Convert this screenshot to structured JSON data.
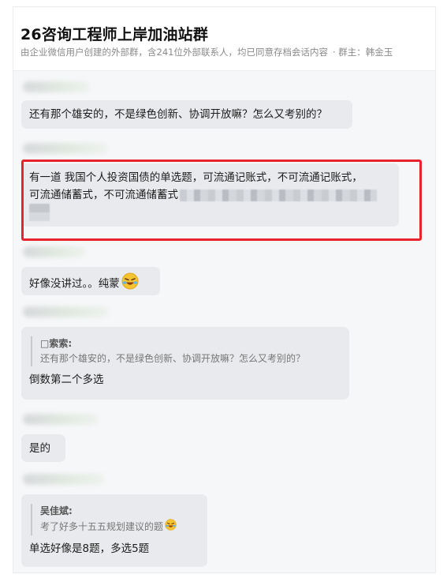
{
  "header": {
    "title": "26咨询工程师上岸加油站群",
    "subtitle": "由企业微信用户创建的外部群，含241位外部联系人，均已同意存档会话内容",
    "owner": "· 群主：韩金玉"
  },
  "messages": [
    {
      "text": "还有那个雄安的，不是绿色创新、协调开放嘛？怎么又考别的？"
    },
    {
      "line1": "有一道 我国个人投资国债的单选题，可流通记账式，不可流通记账式，",
      "line2": "可流通储蓄式，不可流通储蓄式"
    },
    {
      "text": "好像没讲过。。纯蒙",
      "emoji": "laughing-tears-icon"
    },
    {
      "quote_name": "□索索:",
      "quote_text": "还有那个雄安的，不是绿色创新、协调开放嘛？怎么又考别的？",
      "reply": "倒数第二个多选"
    },
    {
      "text": "是的"
    },
    {
      "quote_name": "吴佳斌:",
      "quote_text": "考了好多十五五规划建议的题",
      "quote_emoji": "laughing-tears-icon",
      "reply": "单选好像是8题，多选5题"
    }
  ],
  "colors": {
    "highlight": "#e8232e",
    "bubble": "#e9eaed",
    "chat_bg": "#f6f7f9"
  }
}
